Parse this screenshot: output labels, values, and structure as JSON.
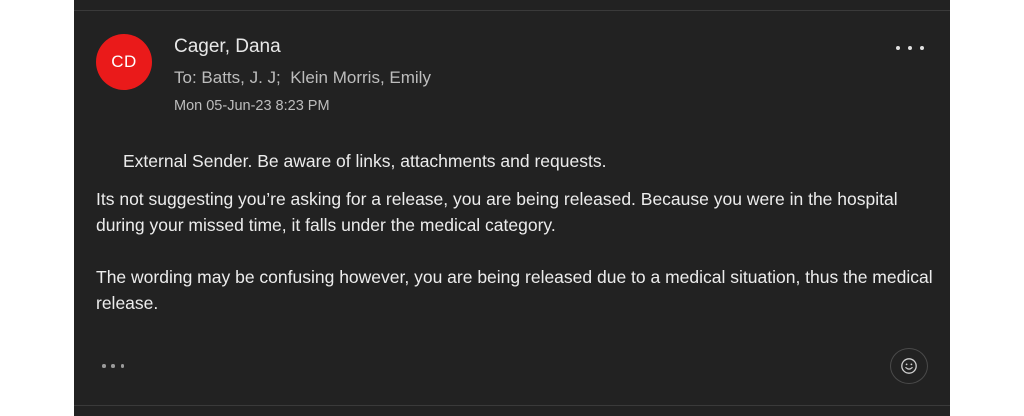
{
  "message": {
    "avatar_initials": "CD",
    "sender_name": "Cager, Dana",
    "recipients": "To: Batts, J. J;  Klein Morris, Emily",
    "date": "Mon 05-Jun-23 8:23 PM",
    "external_notice": "External Sender. Be aware of links, attachments and requests.",
    "body_paragraphs": [
      "Its not suggesting you’re asking for a release, you are being released. Because you were in the hospital during your missed time, it falls under the medical category.",
      "The wording may be confusing however, you are being released due to a medical situation, thus the medical release."
    ]
  },
  "icons": {
    "more_options": "more-horizontal-icon",
    "reaction": "smiley-icon",
    "expand": "ellipsis-icon"
  },
  "colors": {
    "background": "#222222",
    "avatar": "#ea1a1a",
    "text": "#ececec",
    "secondary_text": "#bdbdbd"
  }
}
